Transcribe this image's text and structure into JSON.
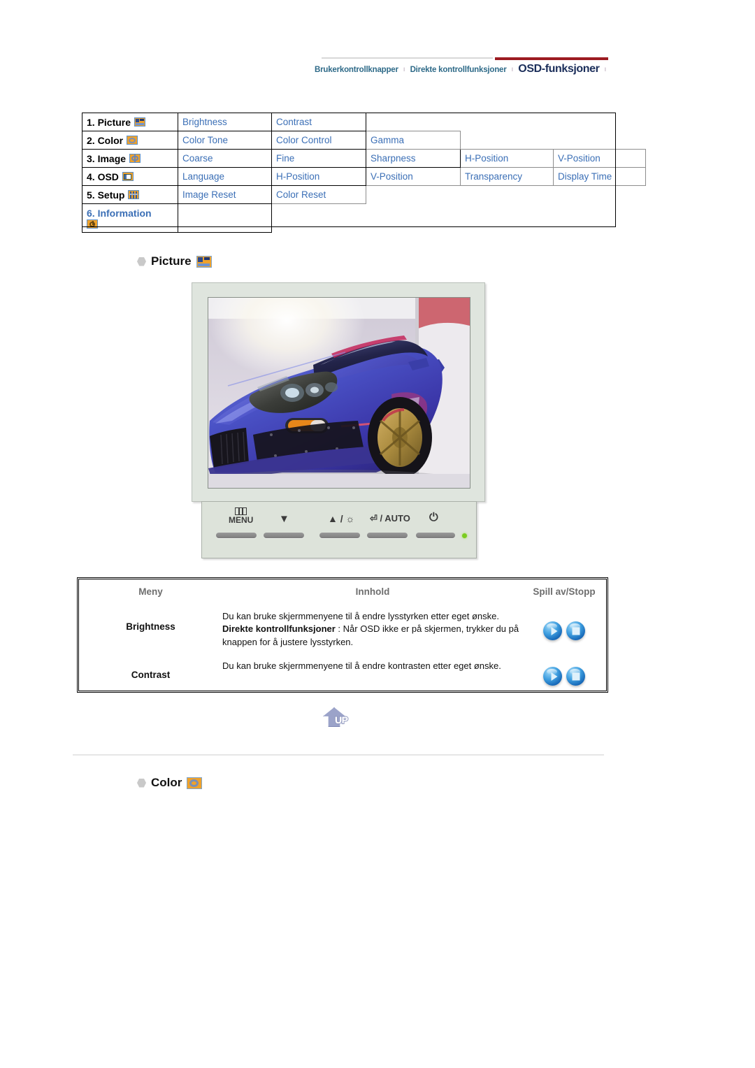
{
  "header": {
    "links": [
      {
        "label": "Brukerkontrollknapper",
        "current": false
      },
      {
        "label": "Direkte kontrollfunksjoner",
        "current": false
      },
      {
        "label": "OSD-funksjoner",
        "current": true
      }
    ],
    "separator": "ı",
    "accent_color": "#9c1b21",
    "link_color": "#2e6a88",
    "current_color": "#1b2e5a"
  },
  "menu_map": {
    "rows": [
      {
        "label": "1. Picture",
        "icon": "picture-icon",
        "label_is_link": false,
        "items": [
          "Brightness",
          "Contrast"
        ]
      },
      {
        "label": "2. Color",
        "icon": "color-icon",
        "label_is_link": false,
        "items": [
          "Color Tone",
          "Color Control",
          "Gamma"
        ]
      },
      {
        "label": "3. Image",
        "icon": "image-icon",
        "label_is_link": false,
        "items": [
          "Coarse",
          "Fine",
          "Sharpness",
          "H-Position",
          "V-Position"
        ]
      },
      {
        "label": "4. OSD",
        "icon": "osd-icon",
        "label_is_link": false,
        "items": [
          "Language",
          "H-Position",
          "V-Position",
          "Transparency",
          "Display Time"
        ]
      },
      {
        "label": "5. Setup",
        "icon": "setup-icon",
        "label_is_link": false,
        "items": [
          "Image Reset",
          "Color Reset"
        ]
      },
      {
        "label": "6. Information",
        "icon": "information-icon",
        "label_is_link": true,
        "items": []
      }
    ],
    "link_color": "#3b6fb6"
  },
  "sections": {
    "picture": {
      "title": "Picture",
      "icon": "picture-icon"
    },
    "color": {
      "title": "Color",
      "icon": "color-icon"
    }
  },
  "monitor": {
    "screen_alt": "blue-sports-car-photo",
    "controls": [
      {
        "label": "MENU",
        "icon": "menu-glyph-icon"
      },
      {
        "label": "▼",
        "icon": "down-arrow-icon"
      },
      {
        "label": "▲ / ☼",
        "icon": "up-brightness-icon"
      },
      {
        "label": "⏎ / AUTO",
        "icon": "enter-auto-icon"
      },
      {
        "label": "⏻",
        "icon": "power-icon"
      }
    ],
    "power_led": "power-led-indicator"
  },
  "content_table": {
    "headers": {
      "meny": "Meny",
      "innhold": "Innhold",
      "spill": "Spill av/Stopp"
    },
    "rows": [
      {
        "menu": "Brightness",
        "line1": "Du kan bruke skjermmenyene til å endre lysstyrken etter eget ønske.",
        "bold_lead": "Direkte kontrollfunksjoner",
        "line2": " : Når OSD ikke er på skjermen, trykker du på knappen for å justere lysstyrken.",
        "play_label": "play-button",
        "stop_label": "stop-button"
      },
      {
        "menu": "Contrast",
        "line1": "Du kan bruke skjermmenyene til å endre kontrasten etter eget ønske.",
        "bold_lead": "",
        "line2": "",
        "play_label": "play-button",
        "stop_label": "stop-button"
      }
    ]
  },
  "up_button": {
    "label": "UP"
  }
}
